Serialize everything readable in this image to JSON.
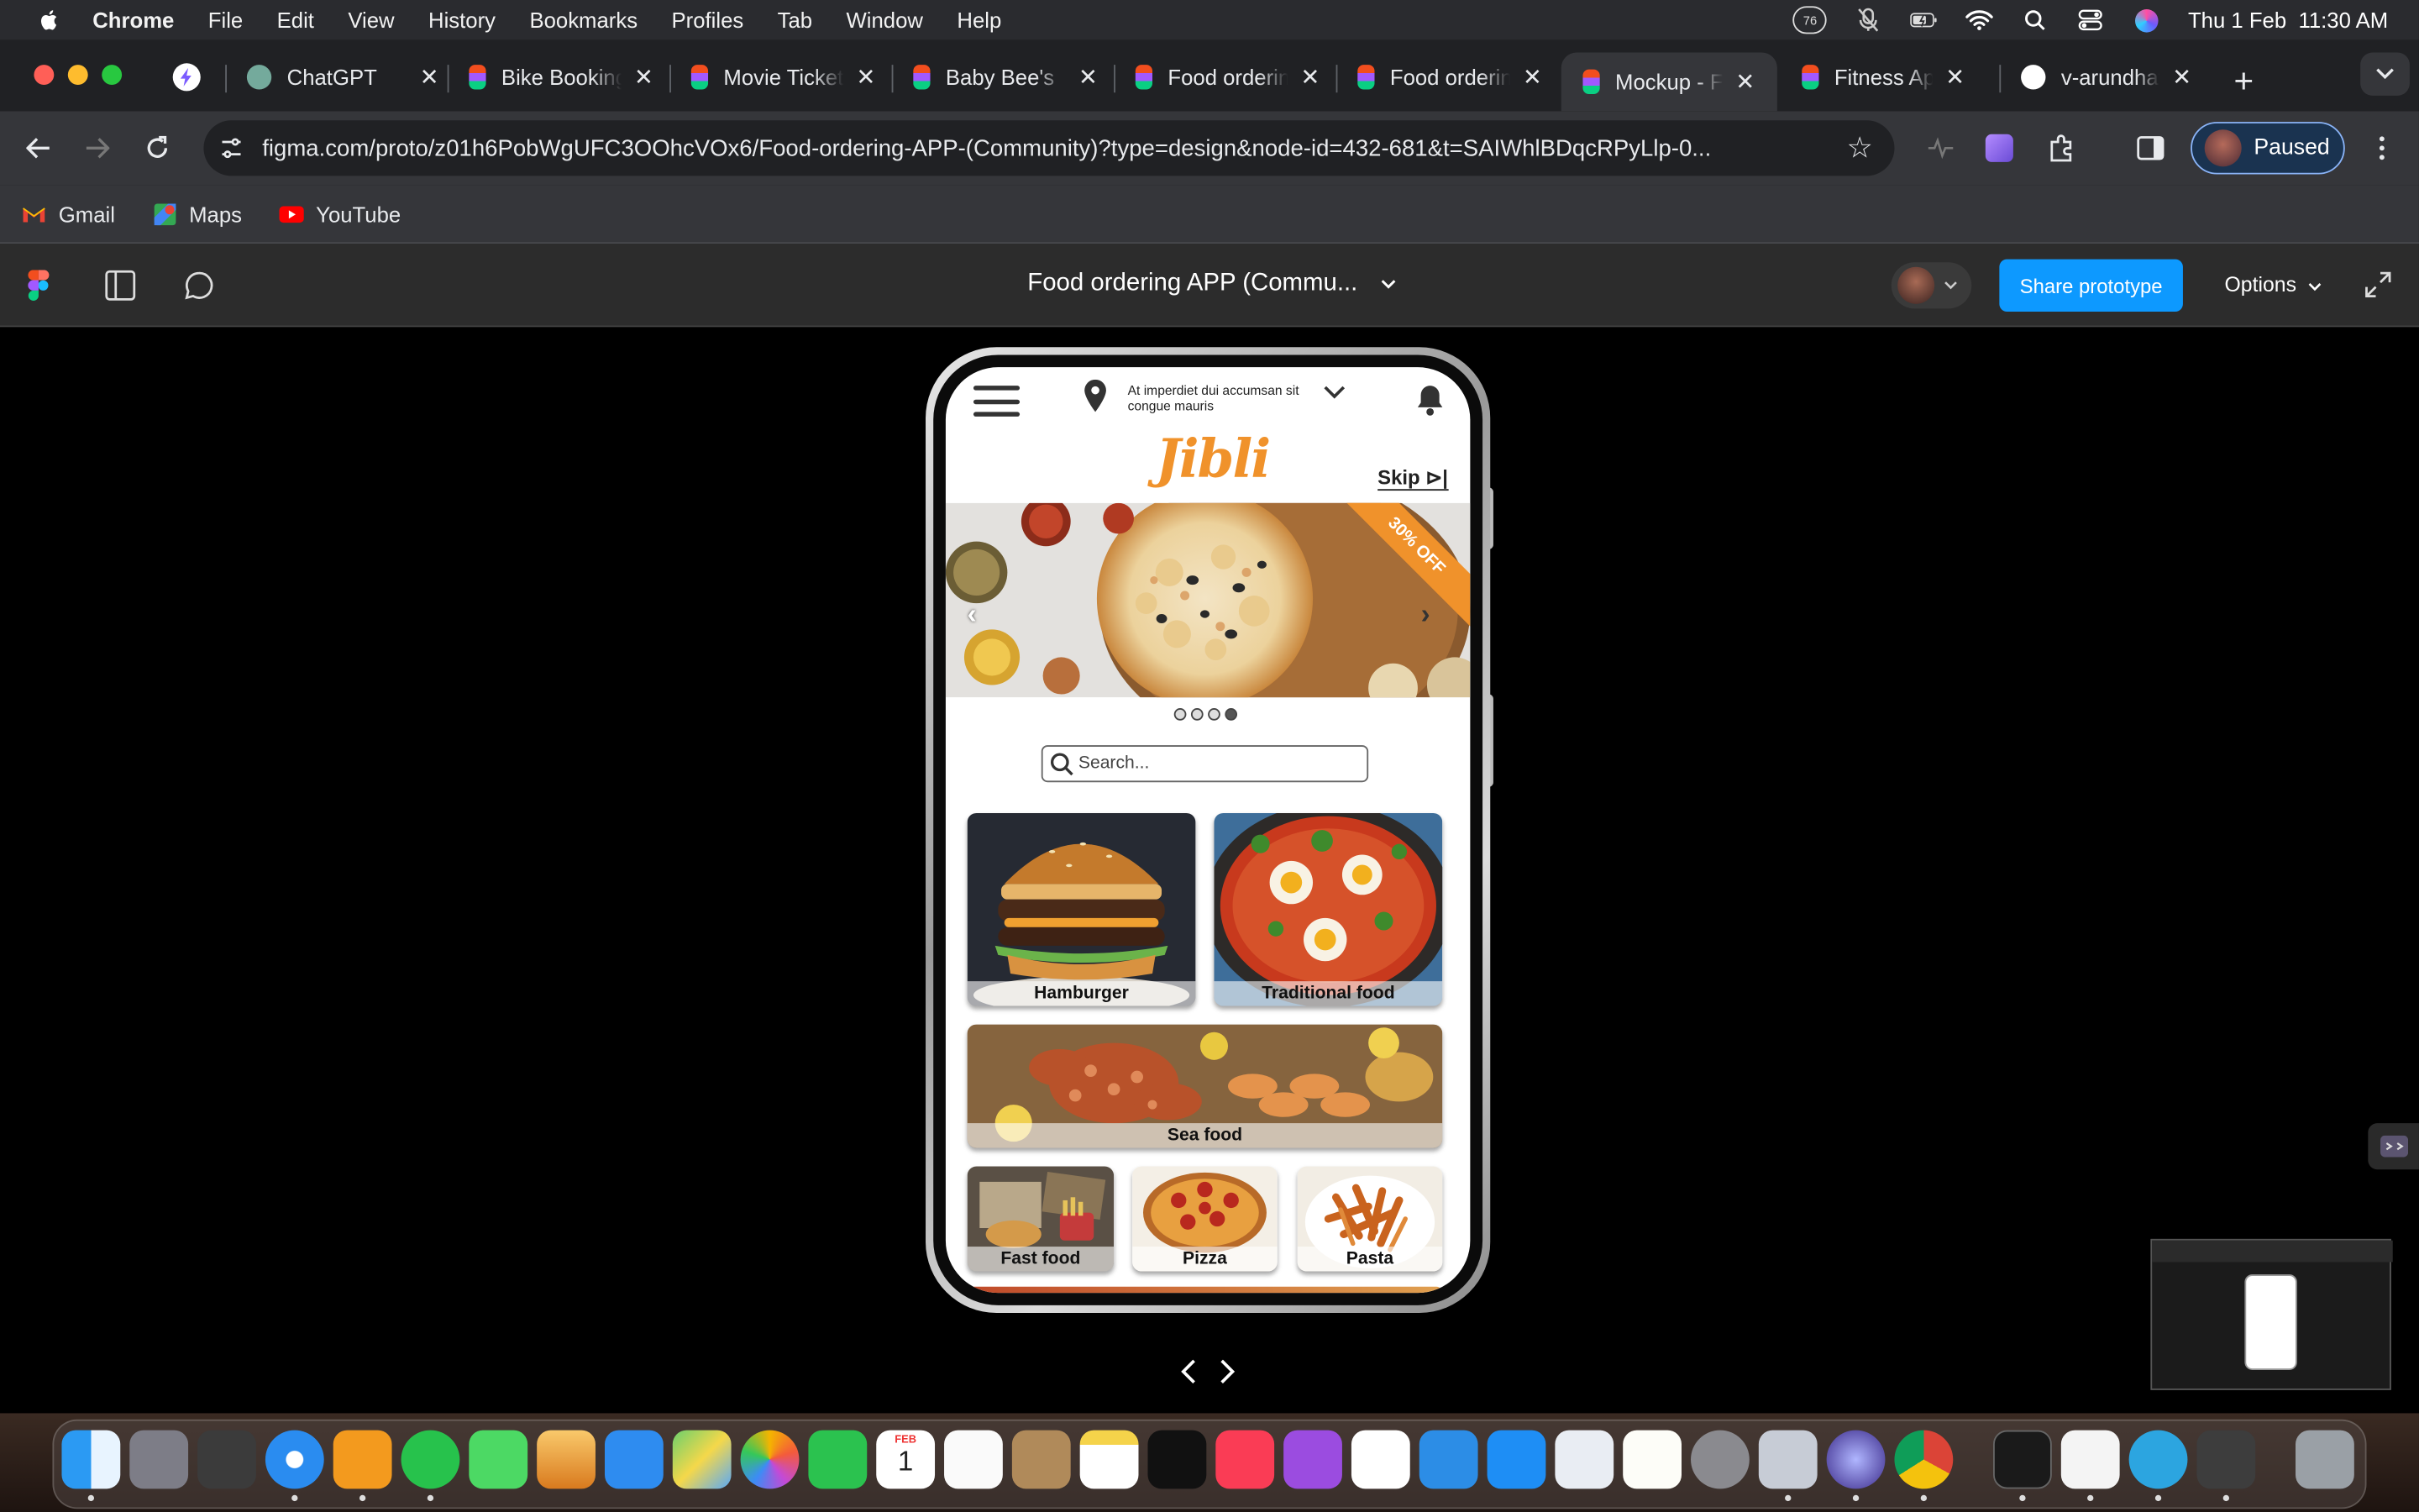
{
  "menubar": {
    "app": "Chrome",
    "items": [
      "File",
      "Edit",
      "View",
      "History",
      "Bookmarks",
      "Profiles",
      "Tab",
      "Window",
      "Help"
    ],
    "notif_count": "76",
    "datetime": "Thu 1 Feb  11:30 AM"
  },
  "tabs": [
    {
      "label": "ChatGPT",
      "color": "#74aa9c"
    },
    {
      "label": "Bike Booking",
      "color": "#f24e1e"
    },
    {
      "label": "Movie Ticket",
      "color": "#a259ff"
    },
    {
      "label": "Baby Bee's",
      "color": "#1abcfe"
    },
    {
      "label": "Food ordering",
      "color": "#0acf83"
    },
    {
      "label": "Food ordering",
      "color": "#f24e1e"
    },
    {
      "label": "Mockup - Food",
      "color": "#a259ff"
    },
    {
      "label": "Fitness App",
      "color": "#f24e1e"
    },
    {
      "label": "v-arundhathi",
      "color": "#ffffff"
    }
  ],
  "toolbar": {
    "url": "figma.com/proto/z01h6PobWgUFC3OOhcVOx6/Food-ordering-APP-(Community)?type=design&node-id=432-681&t=SAIWhlBDqcRPyLlp-0...",
    "profile_label": "Paused"
  },
  "bookmarks": [
    {
      "label": "Gmail"
    },
    {
      "label": "Maps"
    },
    {
      "label": "YouTube"
    }
  ],
  "figma": {
    "title": "Food ordering APP (Commu...",
    "share_label": "Share prototype",
    "options_label": "Options"
  },
  "app": {
    "address": "At imperdiet dui accumsan sit congue mauris",
    "logo": "Jibli",
    "skip": "Skip ⊳|",
    "offer": "30% OFF",
    "search_placeholder": "Search...",
    "categories": [
      {
        "label": "Hamburger"
      },
      {
        "label": "Traditional food"
      },
      {
        "label": "Sea food"
      },
      {
        "label": "Fast food"
      },
      {
        "label": "Pizza"
      },
      {
        "label": "Pasta"
      }
    ],
    "accent": "#f0922b"
  },
  "calendar": {
    "month": "FEB",
    "day": "1"
  }
}
